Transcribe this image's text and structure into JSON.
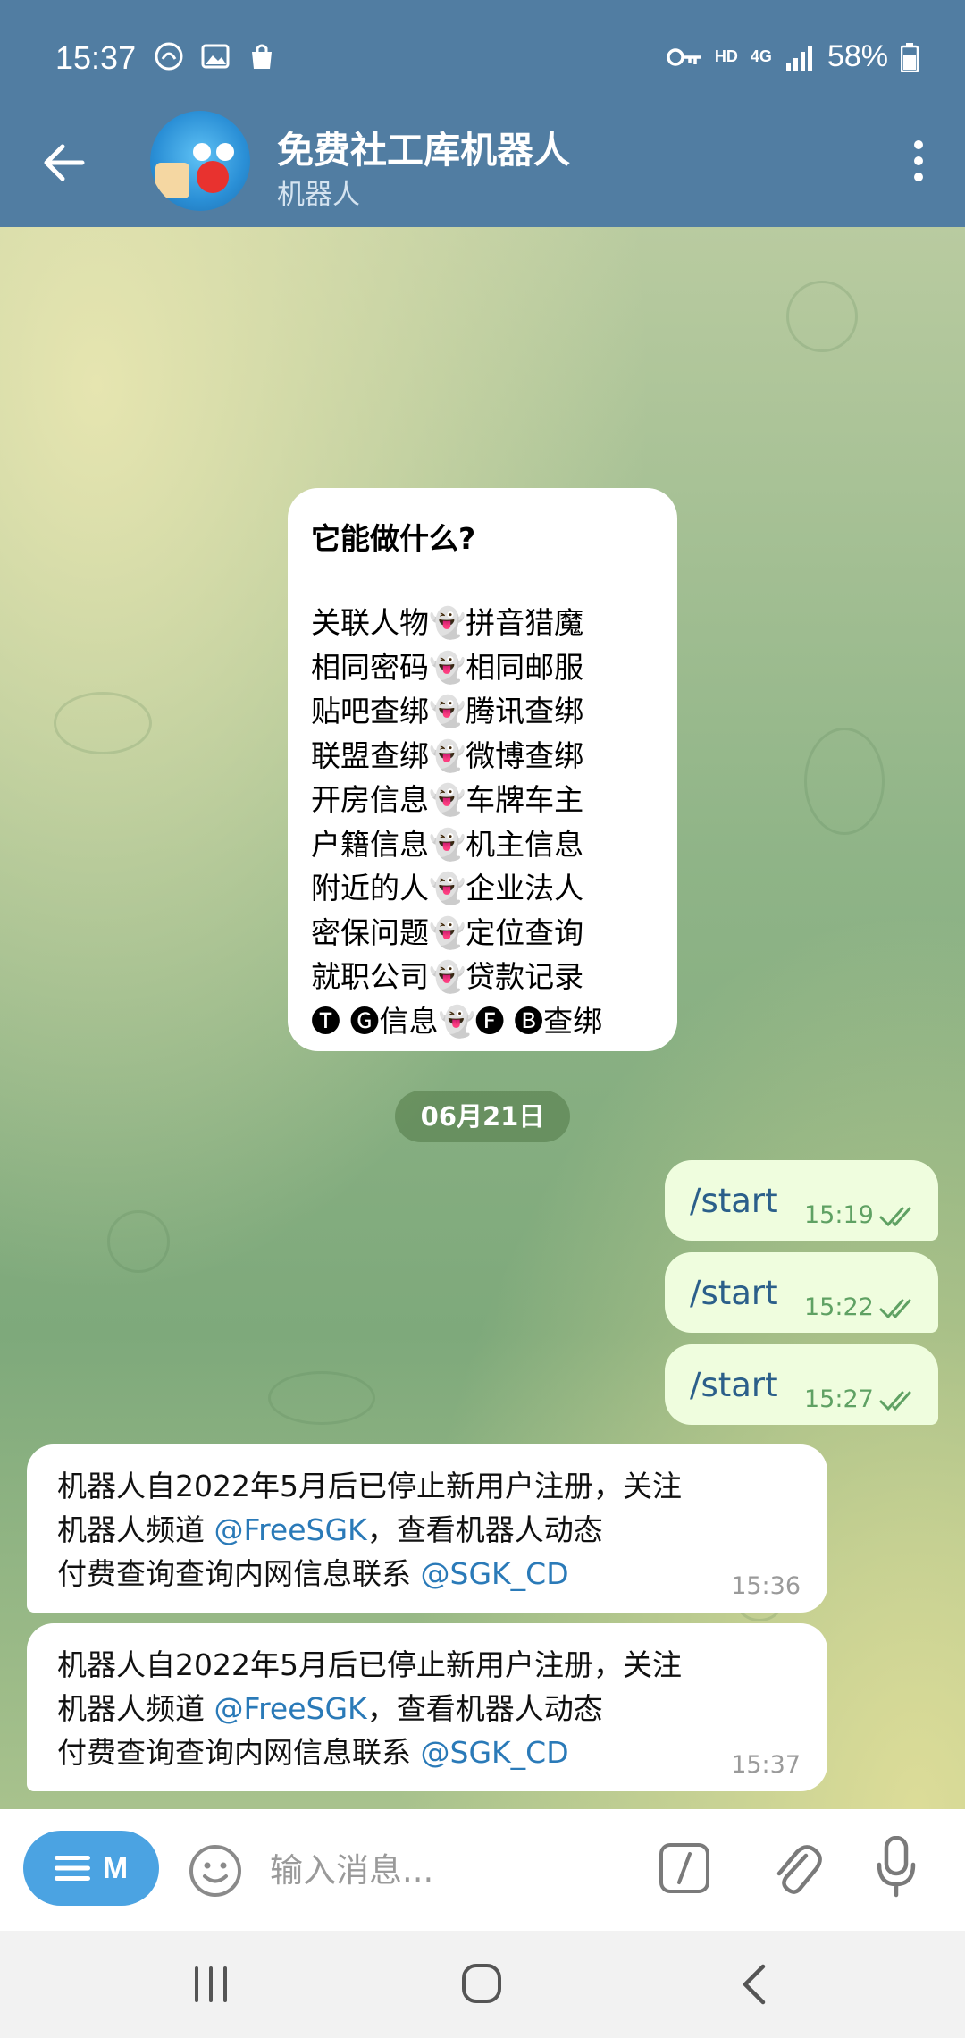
{
  "status_bar": {
    "time": "15:37",
    "network_type": "HD",
    "signal_label": "4G",
    "battery": "58%"
  },
  "header": {
    "title": "免费社工库机器人",
    "subtitle": "机器人"
  },
  "info_card": {
    "title": "它能做什么?",
    "lines": [
      "关联人物👻拼音猎魔",
      "相同密码👻相同邮服",
      "贴吧查绑👻腾讯查绑",
      "联盟查绑👻微博查绑",
      "开房信息👻车牌车主",
      "户籍信息👻机主信息",
      "附近的人👻企业法人",
      "密保问题👻定位查询",
      "就职公司👻贷款记录",
      "🅣 🅖信息👻🅕 🅑查绑"
    ]
  },
  "date_separator": "06月21日",
  "outgoing": [
    {
      "text": "/start",
      "time": "15:19"
    },
    {
      "text": "/start",
      "time": "15:22"
    },
    {
      "text": "/start",
      "time": "15:27"
    }
  ],
  "incoming": [
    {
      "line1": "机器人自2022年5月后已停止新用户注册，关注",
      "line2_prefix": "机器人频道 ",
      "line2_link": "@FreeSGK",
      "line2_suffix": "，查看机器人动态",
      "line3_prefix": "付费查询查询内网信息联系 ",
      "line3_link": "@SGK_CD",
      "time": "15:36"
    },
    {
      "line1": "机器人自2022年5月后已停止新用户注册，关注",
      "line2_prefix": "机器人频道 ",
      "line2_link": "@FreeSGK",
      "line2_suffix": "，查看机器人动态",
      "line3_prefix": "付费查询查询内网信息联系 ",
      "line3_link": "@SGK_CD",
      "time": "15:37"
    }
  ],
  "composer": {
    "menu_label": "M",
    "placeholder": "输入消息..."
  },
  "colors": {
    "header": "#517da2",
    "outgoing_bubble": "#effdde",
    "link": "#2a7ab8",
    "menu_button": "#4ba3e2"
  }
}
